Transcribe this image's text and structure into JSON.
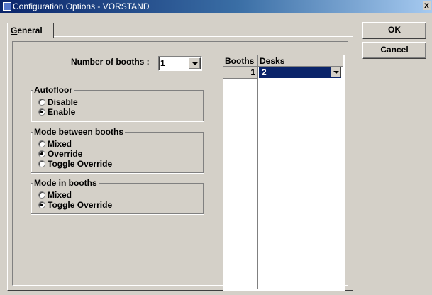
{
  "window": {
    "title": "Configuration Options - VORSTAND",
    "close_glyph": "x"
  },
  "tabs": [
    {
      "label_prefix": "G",
      "label_rest": "eneral"
    }
  ],
  "buttons": {
    "ok": "OK",
    "cancel": "Cancel"
  },
  "booths": {
    "label": "Number of booths :",
    "value": "1"
  },
  "autofloor": {
    "legend": "Autofloor",
    "options": [
      {
        "label": "Disable",
        "checked": false
      },
      {
        "label": "Enable",
        "checked": true
      }
    ]
  },
  "mode_between": {
    "legend": "Mode between booths",
    "options": [
      {
        "label": "Mixed",
        "checked": false
      },
      {
        "label": "Override",
        "checked": true
      },
      {
        "label": "Toggle Override",
        "checked": false
      }
    ]
  },
  "mode_in": {
    "legend": "Mode in booths",
    "options": [
      {
        "label": "Mixed",
        "checked": false
      },
      {
        "label": "Toggle Override",
        "checked": true
      }
    ]
  },
  "grid": {
    "headers": [
      "Booths",
      "Desks"
    ],
    "rows": [
      {
        "booth": "1",
        "desks": "2"
      }
    ]
  }
}
